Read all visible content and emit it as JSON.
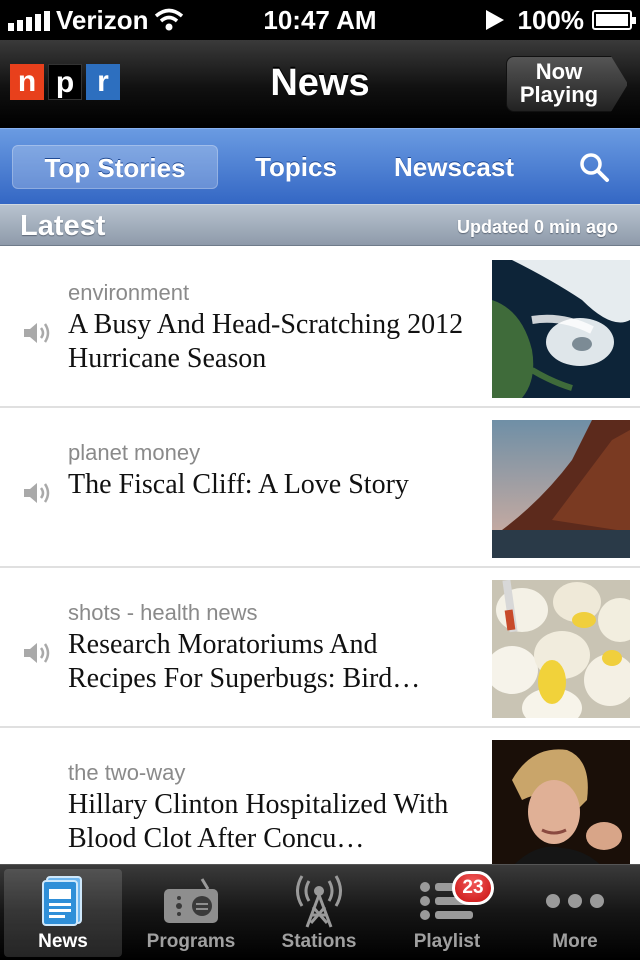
{
  "status_bar": {
    "carrier": "Verizon",
    "time": "10:47 AM",
    "battery": "100%"
  },
  "nav_bar": {
    "logo_letters": [
      "n",
      "p",
      "r"
    ],
    "title": "News",
    "now_playing_line1": "Now",
    "now_playing_line2": "Playing"
  },
  "sub_tabs": [
    {
      "label": "Top Stories",
      "active": true
    },
    {
      "label": "Topics",
      "active": false
    },
    {
      "label": "Newscast",
      "active": false
    }
  ],
  "latest": {
    "title": "Latest",
    "updated": "Updated 0 min ago"
  },
  "stories": [
    {
      "topic": "environment",
      "headline": "A Busy And Head-Scratching 2012 Hurricane Season",
      "has_audio": true,
      "thumb": "hurricane-satellite-image"
    },
    {
      "topic": "planet money",
      "headline": "The Fiscal Cliff: A Love Story",
      "has_audio": true,
      "thumb": "cliff-over-water-image"
    },
    {
      "topic": "shots - health news",
      "headline": "Research Moratoriums And Recipes For Superbugs: Bird…",
      "has_audio": true,
      "thumb": "eggs-injection-image"
    },
    {
      "topic": "the two-way",
      "headline": "Hillary Clinton Hospitalized With Blood Clot After Concu…",
      "has_audio": false,
      "thumb": "hillary-clinton-photo"
    }
  ],
  "tab_bar": {
    "items": [
      {
        "label": "News",
        "icon": "news-icon",
        "active": true
      },
      {
        "label": "Programs",
        "icon": "radio-icon",
        "active": false
      },
      {
        "label": "Stations",
        "icon": "antenna-icon",
        "active": false
      },
      {
        "label": "Playlist",
        "icon": "playlist-icon",
        "active": false
      },
      {
        "label": "More",
        "icon": "more-icon",
        "active": false
      }
    ],
    "playlist_badge": "23"
  },
  "colors": {
    "accent_blue": "#3467c4",
    "npr_red": "#e8401c",
    "npr_blue": "#2d6fbf",
    "badge_red": "#c71010"
  }
}
